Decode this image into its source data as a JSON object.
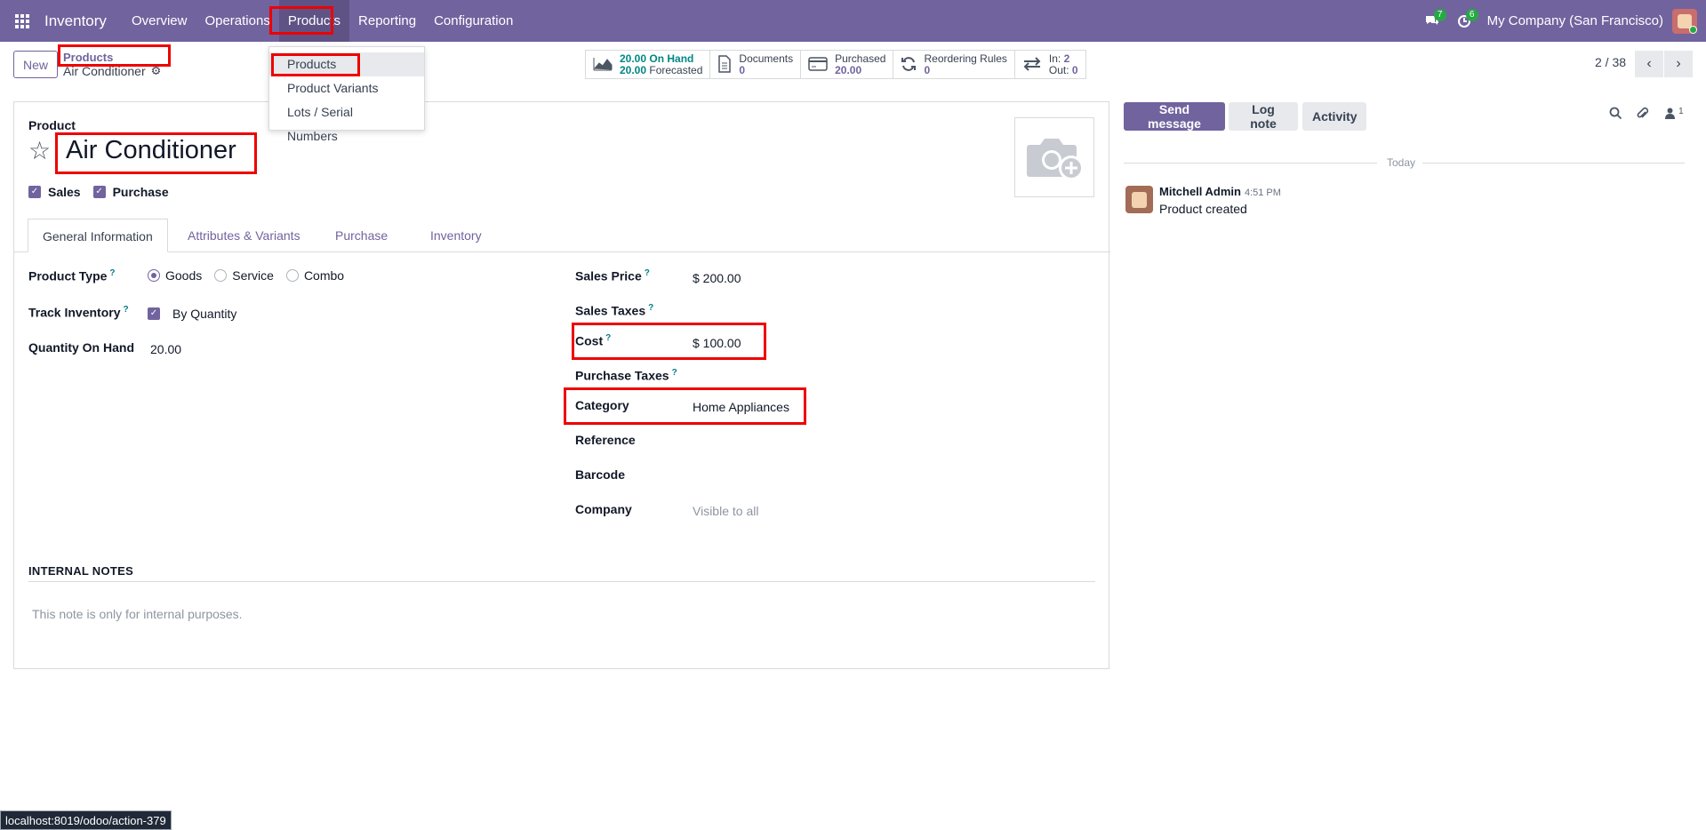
{
  "navbar": {
    "app_name": "Inventory",
    "menu": [
      "Overview",
      "Operations",
      "Products",
      "Reporting",
      "Configuration"
    ],
    "messages_count": "7",
    "activities_count": "6",
    "company": "My Company (San Francisco)"
  },
  "control": {
    "new_label": "New",
    "breadcrumb_parent": "Products",
    "breadcrumb_current": "Air Conditioner",
    "pager": "2 / 38"
  },
  "smart_buttons": {
    "on_hand_value": "20.00",
    "on_hand_label": "On Hand",
    "forecast_value": "20.00",
    "forecast_label": "Forecasted",
    "documents_label": "Documents",
    "documents_value": "0",
    "purchased_label": "Purchased",
    "purchased_value": "20.00",
    "reordering_label": "Reordering Rules",
    "reordering_value": "0",
    "in_label": "In:",
    "in_value": "2",
    "out_label": "Out:",
    "out_value": "0"
  },
  "dropdown": {
    "items": [
      "Products",
      "Product Variants",
      "Lots / Serial Numbers"
    ]
  },
  "form": {
    "product_label": "Product",
    "name": "Air Conditioner",
    "sales_label": "Sales",
    "purchase_label": "Purchase",
    "tabs": [
      "General Information",
      "Attributes & Variants",
      "Purchase",
      "Inventory"
    ],
    "product_type_label": "Product Type",
    "type_options": [
      "Goods",
      "Service",
      "Combo"
    ],
    "track_inventory_label": "Track Inventory",
    "by_quantity_label": "By Quantity",
    "qty_on_hand_label": "Quantity On Hand",
    "qty_on_hand": "20.00",
    "sales_price_label": "Sales Price",
    "sales_price": "$ 200.00",
    "sales_taxes_label": "Sales Taxes",
    "cost_label": "Cost",
    "cost": "$ 100.00",
    "purchase_taxes_label": "Purchase Taxes",
    "category_label": "Category",
    "category": "Home Appliances",
    "reference_label": "Reference",
    "barcode_label": "Barcode",
    "company_label": "Company",
    "company_placeholder": "Visible to all",
    "help_mark": "?",
    "notes_title": "INTERNAL NOTES",
    "notes_placeholder": "This note is only for internal purposes."
  },
  "chatter": {
    "send_message": "Send message",
    "log_note": "Log note",
    "activity": "Activity",
    "followers_count": "1",
    "today": "Today",
    "author": "Mitchell Admin",
    "time": "4:51 PM",
    "body": "Product created"
  },
  "statusbar": {
    "url": "localhost:8019/odoo/action-379"
  },
  "colors": {
    "brand": "#71639e",
    "accent_teal": "#008784",
    "highlight": "#ee0000"
  }
}
